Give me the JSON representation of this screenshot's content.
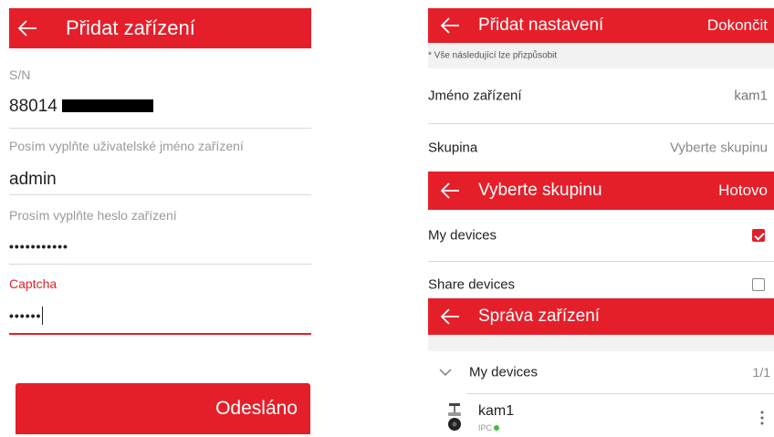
{
  "left": {
    "header": {
      "title": "Přidat zařízení"
    },
    "sn_label": "S/N",
    "sn_value": "88014",
    "user_placeholder": "Posím vyplňte uživatelské jméno zařízení",
    "user_value": "admin",
    "pass_placeholder": "Prosím vyplňte heslo zařízení",
    "pass_value": "•••••••••••",
    "captcha_label": "Captcha",
    "captcha_value": "••••••",
    "submit_label": "Odesláno"
  },
  "right_top": {
    "header": {
      "title": "Přidat nastavení",
      "action": "Dokončit"
    },
    "note": "* Vše následující lze přizpůsobit",
    "rows": [
      {
        "label": "Jméno zařízení",
        "value": "kam1"
      },
      {
        "label": "Skupina",
        "value": "Vyberte skupinu"
      }
    ]
  },
  "right_mid": {
    "header": {
      "title": "Vyberte skupinu",
      "action": "Hotovo"
    },
    "options": [
      {
        "label": "My devices",
        "checked": true
      },
      {
        "label": "Share devices",
        "checked": false
      }
    ]
  },
  "right_bottom": {
    "header": {
      "title": "Správa zařízení"
    },
    "group": {
      "label": "My devices",
      "count": "1/1"
    },
    "device": {
      "name": "kam1",
      "type": "IPC"
    }
  },
  "colors": {
    "accent": "#e51f2a",
    "online": "#3fbf3f"
  }
}
